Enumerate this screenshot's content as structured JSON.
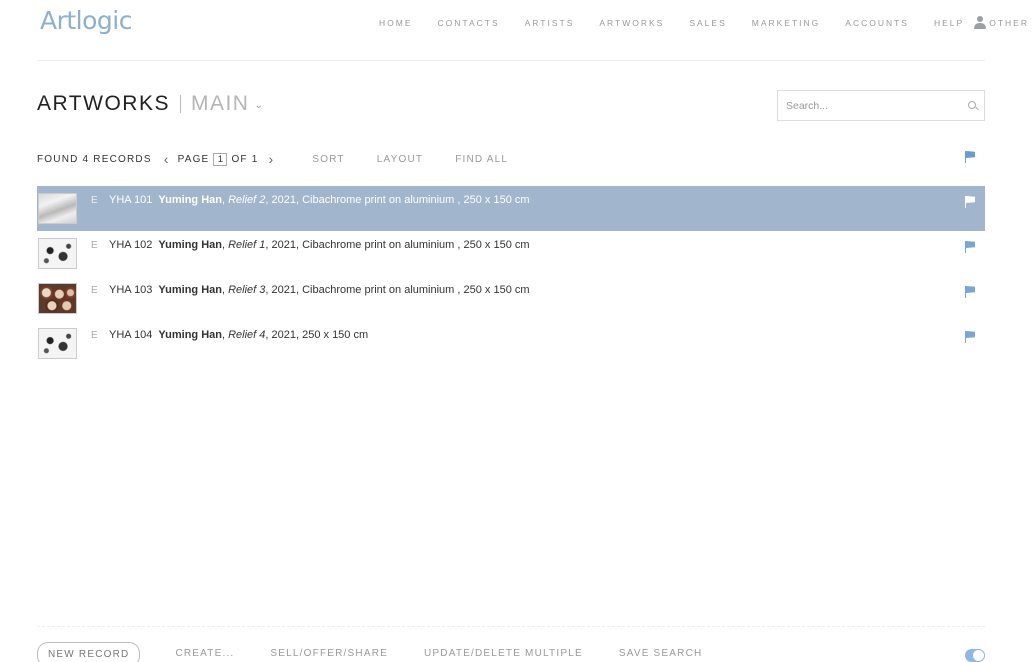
{
  "brand": {
    "logo_text": "Artlogic",
    "accent": "#8fb0cd"
  },
  "nav": {
    "items": [
      "HOME",
      "CONTACTS",
      "ARTISTS",
      "ARTWORKS",
      "SALES",
      "MARKETING",
      "ACCOUNTS",
      "HELP",
      "OTHER"
    ],
    "user_icon": "user-icon"
  },
  "header": {
    "title": "ARTWORKS",
    "subtitle": "MAIN",
    "subtitle_caret": "⌄"
  },
  "search": {
    "placeholder": "Search..."
  },
  "toolbar": {
    "found_label": "FOUND",
    "count": "4",
    "records_label": "RECORDS",
    "page_label": "PAGE",
    "page_current": "1",
    "of_label": "OF 1",
    "prev": "‹",
    "next": "›",
    "sort": "SORT",
    "layout": "LAYOUT",
    "find_all": "FIND ALL"
  },
  "records": [
    {
      "e": "E",
      "ref": "YHA 101",
      "artist": "Yuming Han",
      "title": "Relief 2",
      "details": ", 2021, Cibachrome print on aluminium , 250 x 150 cm",
      "selected": true
    },
    {
      "e": "E",
      "ref": "YHA 102",
      "artist": "Yuming Han",
      "title": "Relief 1",
      "details": ", 2021, Cibachrome print on aluminium , 250 x 150 cm",
      "selected": false
    },
    {
      "e": "E",
      "ref": "YHA 103",
      "artist": "Yuming Han",
      "title": "Relief 3",
      "details": ", 2021, Cibachrome print on aluminium , 250 x 150 cm",
      "selected": false
    },
    {
      "e": "E",
      "ref": "YHA 104",
      "artist": "Yuming Han",
      "title": "Relief 4",
      "details": ", 2021, 250 x 150 cm",
      "selected": false
    }
  ],
  "footer": {
    "new_record": "NEW RECORD",
    "create": "CREATE...",
    "sell": "SELL/OFFER/SHARE",
    "update": "UPDATE/DELETE MULTIPLE",
    "save_search": "SAVE SEARCH"
  },
  "colors": {
    "selected_row": "#a1b5cc",
    "flag": "#7aa6d4",
    "toggle": "#8fb8de"
  }
}
